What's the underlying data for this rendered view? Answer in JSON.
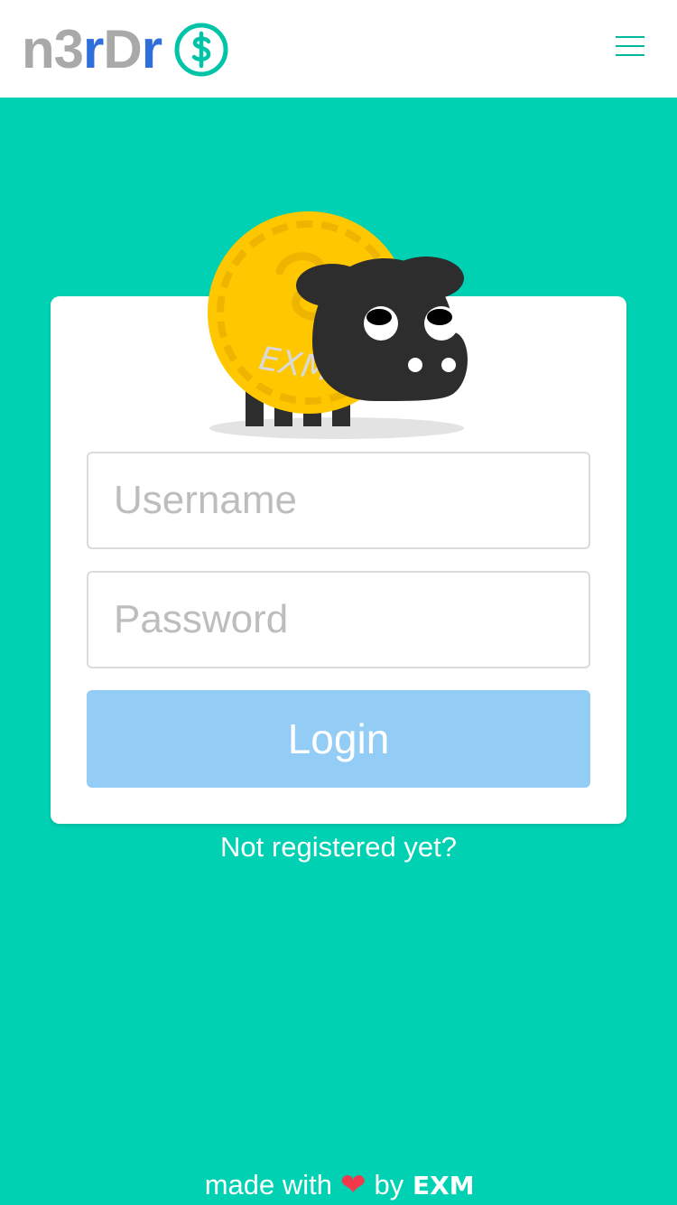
{
  "navbar": {
    "brand_part1": "n3",
    "brand_part2": "r",
    "brand_part3": "D",
    "brand_part4": "r",
    "brand_icon": "dollar-circle-icon",
    "menu_icon": "hamburger-menu-icon"
  },
  "colors": {
    "background": "#00d1b2",
    "brand_gray": "#a9a9a9",
    "brand_blue": "#2f6fdc",
    "login_button": "#93cdf5",
    "heart": "#f2384a"
  },
  "login_form": {
    "mascot": "coin-sheep-mascot",
    "mascot_coin_text": "EXM",
    "username_placeholder": "Username",
    "username_value": "",
    "password_placeholder": "Password",
    "password_value": "",
    "login_label": "Login"
  },
  "register_link": "Not registered yet?",
  "footer": {
    "made_with": "made with",
    "heart_icon": "heart-icon",
    "by": "by",
    "logo_text": "EXM"
  }
}
